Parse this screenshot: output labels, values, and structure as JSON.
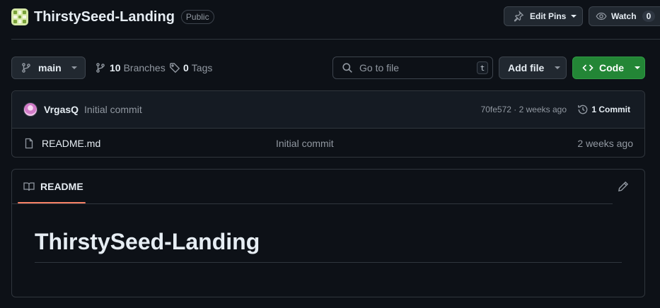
{
  "repo": {
    "name": "ThirstySeed-Landing",
    "visibility": "Public"
  },
  "header_buttons": {
    "edit_pins": "Edit Pins",
    "watch": "Watch",
    "watch_count": "0"
  },
  "toolbar": {
    "branch": "main",
    "branches_count": "10",
    "branches_label": "Branches",
    "tags_count": "0",
    "tags_label": "Tags",
    "search_placeholder": "Go to file",
    "search_shortcut": "t",
    "add_file": "Add file",
    "code": "Code"
  },
  "latest_commit": {
    "author": "VrgasQ",
    "message": "Initial commit",
    "meta": "70fe572 · 2 weeks ago",
    "commit_count": "1 Commit"
  },
  "files": [
    {
      "name": "README.md",
      "icon": "file-icon",
      "commit_message": "Initial commit",
      "date": "2 weeks ago"
    }
  ],
  "readme": {
    "tab_label": "README",
    "heading": "ThirstySeed-Landing"
  },
  "colors": {
    "background": "#0d1117",
    "border": "#30363d",
    "code_button": "#238636",
    "tab_accent": "#f78166",
    "muted_text": "#9198a1"
  }
}
